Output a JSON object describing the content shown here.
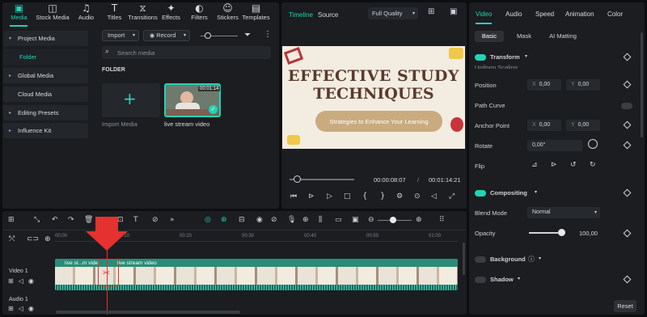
{
  "toolbar": {
    "tabs": [
      {
        "label": "Media",
        "icon": "media-icon",
        "glyph": "▣"
      },
      {
        "label": "Stock Media",
        "icon": "stock-media-icon",
        "glyph": "◫"
      },
      {
        "label": "Audio",
        "icon": "audio-icon",
        "glyph": "♫"
      },
      {
        "label": "Titles",
        "icon": "titles-icon",
        "glyph": "T"
      },
      {
        "label": "Transitions",
        "icon": "transitions-icon",
        "glyph": "⧖"
      },
      {
        "label": "Effects",
        "icon": "effects-icon",
        "glyph": "✦"
      },
      {
        "label": "Filters",
        "icon": "filters-icon",
        "glyph": "◐"
      },
      {
        "label": "Stickers",
        "icon": "stickers-icon",
        "glyph": "☺"
      },
      {
        "label": "Templates",
        "icon": "templates-icon",
        "glyph": "▤"
      }
    ]
  },
  "sidebar": {
    "items": [
      {
        "label": "Project Media",
        "expanded": true
      },
      {
        "label": "Folder",
        "active": true
      },
      {
        "label": "Global Media"
      },
      {
        "label": "Cloud Media"
      },
      {
        "label": "Editing Presets"
      },
      {
        "label": "Influence Kit"
      }
    ]
  },
  "media": {
    "import_label": "Import",
    "record_label": "Record",
    "search_placeholder": "Search media",
    "folder_heading": "FOLDER",
    "import_media_label": "Import Media",
    "clip_name": "live stream video",
    "clip_duration": "00:01:14"
  },
  "preview": {
    "tab_timeline": "Timeline",
    "tab_source": "Source",
    "quality": "Full Quality",
    "slide_title_line1": "EFFECTIVE STUDY",
    "slide_title_line2": "TECHNIQUES",
    "slide_subtitle": "Strategies to Enhance Your Learning",
    "current_time": "00:00:08:07",
    "separator": "/",
    "total_time": "00:01:14:21",
    "progress_fraction": 0.11
  },
  "properties": {
    "tabs": [
      "Video",
      "Audio",
      "Speed",
      "Animation",
      "Color"
    ],
    "subtabs": [
      "Basic",
      "Mask",
      "AI Matting"
    ],
    "transform_label": "Transform",
    "uniform_scaling": "Uniform Scaling",
    "position_label": "Position",
    "position_x": "0,00",
    "position_y": "0,00",
    "x_label": "X",
    "y_label": "Y",
    "path_curve_label": "Path Curve",
    "anchor_label": "Anchor Point",
    "anchor_x": "0,00",
    "anchor_y": "0,00",
    "rotate_label": "Rotate",
    "rotate_value": "0,00°",
    "flip_label": "Flip",
    "compositing_label": "Compositing",
    "blend_label": "Blend Mode",
    "blend_value": "Normal",
    "opacity_label": "Opacity",
    "opacity_value": "100,00",
    "opacity_fraction": 1.0,
    "background_label": "Background",
    "shadow_label": "Shadow",
    "reset_label": "Reset"
  },
  "timeline": {
    "ruler": [
      "00:00",
      "00:10",
      "00:20",
      "00:30",
      "00:40",
      "00:50",
      "01:00"
    ],
    "track_video": "Video 1",
    "track_audio": "Audio 1",
    "clip_label_left": "live st...m vide",
    "clip_label_right": "live stream video"
  },
  "colors": {
    "accent": "#22d3b5",
    "playhead": "#e5312f"
  }
}
